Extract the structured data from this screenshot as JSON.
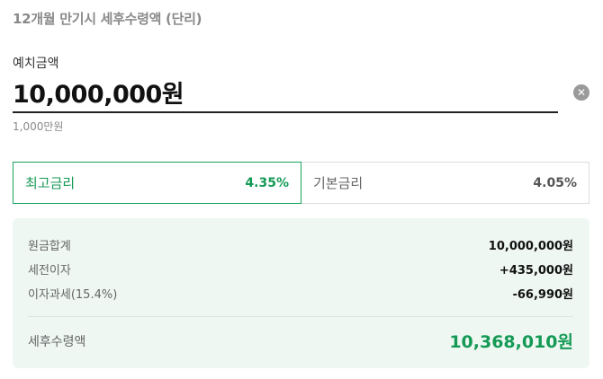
{
  "title": "12개월 만기시 세후수령액 (단리)",
  "deposit": {
    "label": "예치금액",
    "value": "10,000,000원",
    "hint": "1,000만원",
    "clear_icon": "clear-icon"
  },
  "rates": [
    {
      "name": "최고금리",
      "value": "4.35%",
      "selected": true
    },
    {
      "name": "기본금리",
      "value": "4.05%",
      "selected": false
    }
  ],
  "summary": {
    "rows": [
      {
        "label": "원금합계",
        "value": "10,000,000원"
      },
      {
        "label": "세전이자",
        "value": "+435,000원"
      },
      {
        "label": "이자과세(15.4%)",
        "value": "-66,990원"
      }
    ],
    "total_label": "세후수령액",
    "total_value": "10,368,010원"
  },
  "colors": {
    "accent": "#149a55",
    "summary_bg": "#eef7f2"
  }
}
